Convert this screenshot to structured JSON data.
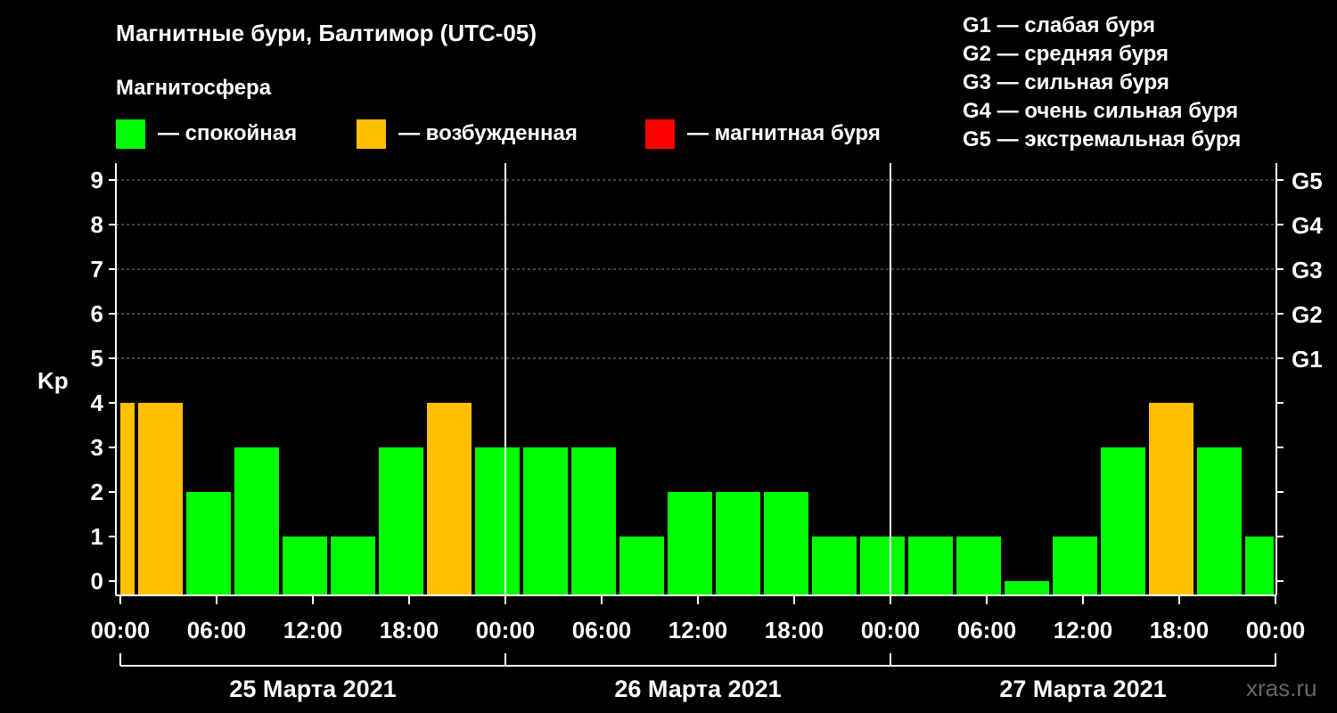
{
  "header": {
    "title": "Магнитные бури, Балтимор (UTC-05)",
    "subtitle": "Магнитосфера",
    "legend": [
      {
        "label": "— спокойная",
        "color": "#00ff00"
      },
      {
        "label": "— возбужденная",
        "color": "#ffc000"
      },
      {
        "label": "— магнитная буря",
        "color": "#ff0000"
      }
    ]
  },
  "g_legend": [
    "G1 — слабая буря",
    "G2 — средняя буря",
    "G3 — сильная буря",
    "G4 — очень сильная буря",
    "G5 — экстремальная буря"
  ],
  "watermark": "xras.ru",
  "chart_data": {
    "type": "bar",
    "title": "Магнитные бури, Балтимор (UTC-05)",
    "ylabel": "Kp",
    "ylim": [
      0,
      9
    ],
    "yticks": [
      0,
      1,
      2,
      3,
      4,
      5,
      6,
      7,
      8,
      9
    ],
    "right_ticks": [
      {
        "value": 5,
        "label": "G1"
      },
      {
        "value": 6,
        "label": "G2"
      },
      {
        "value": 7,
        "label": "G3"
      },
      {
        "value": 8,
        "label": "G4"
      },
      {
        "value": 9,
        "label": "G5"
      }
    ],
    "xtick_labels": [
      "00:00",
      "06:00",
      "12:00",
      "18:00",
      "00:00",
      "06:00",
      "12:00",
      "18:00",
      "00:00",
      "06:00",
      "12:00",
      "18:00",
      "00:00"
    ],
    "day_labels": [
      "25 Марта 2021",
      "26 Марта 2021",
      "27 Марта 2021"
    ],
    "bar_start_hours": [
      0,
      1,
      4,
      7,
      10,
      13,
      16,
      19,
      22,
      25,
      28,
      31,
      34,
      37,
      40,
      43,
      46,
      49,
      52,
      55,
      58,
      61,
      64,
      67,
      70
    ],
    "values": [
      4,
      4,
      2,
      3,
      1,
      1,
      3,
      4,
      3,
      3,
      3,
      1,
      2,
      2,
      2,
      1,
      1,
      1,
      1,
      0,
      1,
      3,
      4,
      3,
      1
    ],
    "colors": {
      "quiet": "#00ff00",
      "active": "#ffc000",
      "storm": "#ff0000"
    },
    "grid": "dashed horizontal at 5–9, vertical lines at day boundaries"
  }
}
